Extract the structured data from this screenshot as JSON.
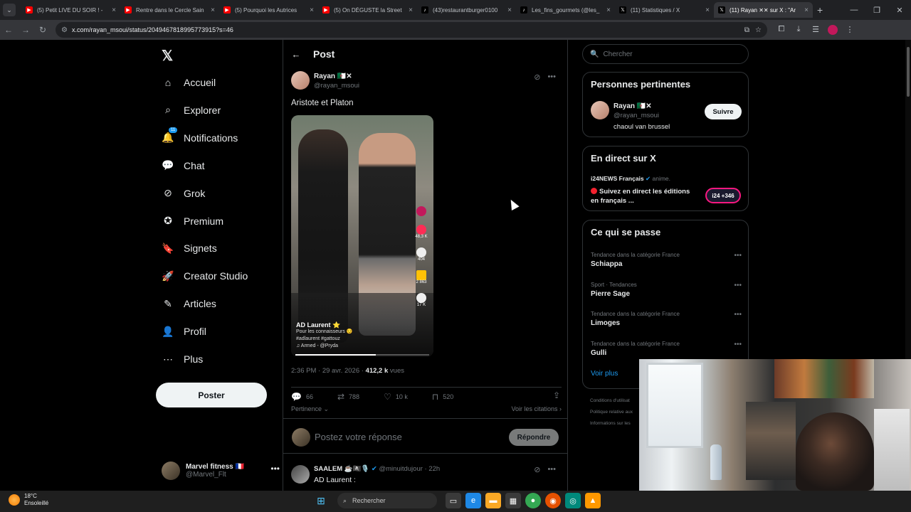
{
  "browser": {
    "tabs": [
      {
        "title": "(5) Petit LIVE DU SOIR ! -",
        "color": "#ff0000",
        "icon": "youtube-icon"
      },
      {
        "title": "Rentre dans le Cercle Sain",
        "color": "#ff0000",
        "icon": "youtube-icon"
      },
      {
        "title": "(5) Pourquoi les Autrices",
        "color": "#ff0000",
        "icon": "youtube-icon"
      },
      {
        "title": "(5) On DÉGUSTE la Street",
        "color": "#ff0000",
        "icon": "youtube-icon"
      },
      {
        "title": "(43)restaurantburger0100",
        "color": "#000000",
        "icon": "tiktok-icon"
      },
      {
        "title": "Les_fins_gourmets (@les_",
        "color": "#000000",
        "icon": "tiktok-icon"
      },
      {
        "title": "(11) Statistiques / X",
        "color": "#000000",
        "icon": "x-icon"
      },
      {
        "title": "(11) Rayan ✕✕ sur X : \"Ar",
        "color": "#000000",
        "icon": "x-icon",
        "active": true
      }
    ],
    "url": "x.com/rayan_msoui/status/2049467818995773915?s=46"
  },
  "nav": {
    "items": [
      {
        "label": "Accueil",
        "icon": "home-icon"
      },
      {
        "label": "Explorer",
        "icon": "search-icon"
      },
      {
        "label": "Notifications",
        "icon": "bell-icon",
        "badge": "11"
      },
      {
        "label": "Chat",
        "icon": "chat-icon"
      },
      {
        "label": "Grok",
        "icon": "grok-icon"
      },
      {
        "label": "Premium",
        "icon": "premium-icon"
      },
      {
        "label": "Signets",
        "icon": "bookmark-icon"
      },
      {
        "label": "Creator Studio",
        "icon": "rocket-icon"
      },
      {
        "label": "Articles",
        "icon": "articles-icon"
      },
      {
        "label": "Profil",
        "icon": "profile-icon"
      },
      {
        "label": "Plus",
        "icon": "more-circle-icon"
      }
    ],
    "post_button": "Poster",
    "account": {
      "name": "Marvel fitness 🇫🇷",
      "handle": "@Marvel_Flt"
    }
  },
  "main": {
    "header_title": "Post",
    "tweet": {
      "author": "Rayan 🇩🇿✕",
      "handle": "@rayan_msoui",
      "text": "Aristote et Platon",
      "video": {
        "caption_user": "AD Laurent ⭐",
        "caption_line1": "Pour les connaisseurs 😏",
        "caption_line2": "#adlaurent #gattouz",
        "caption_music": "♫ Armed - @Pryda",
        "likes": "48,3 K",
        "comments": "404",
        "saves": "2 863",
        "shares": "17 K",
        "progress": 0.6
      },
      "time": "2:36 PM · 29 avr. 2026 · ",
      "views_count": "412,2 k",
      "views_label": " vues",
      "replies": "66",
      "reposts": "788",
      "likes": "10 k",
      "bookmarks": "520"
    },
    "sort_label": "Pertinence ⌄",
    "quotes_label": "Voir les citations ›",
    "reply_placeholder": "Postez votre réponse",
    "reply_button": "Répondre",
    "reply_tweet": {
      "author": "SAALEM ☕🏴‍☠️🎙️",
      "handle": "@minuitdujour",
      "time": " · 22h",
      "text": "AD Laurent :"
    }
  },
  "right": {
    "search_placeholder": "Chercher",
    "relevant": {
      "title": "Personnes pertinentes",
      "name": "Rayan 🇩🇿✕",
      "handle": "@rayan_msoui",
      "bio": "chaoul van brussel",
      "follow": "Suivre"
    },
    "live": {
      "title": "En direct sur X",
      "source": "i24NEWS Français",
      "suffix": " anime.",
      "headline": "Suivez en direct les éditions en français ...",
      "badge": "i24 +346"
    },
    "trending": {
      "title": "Ce qui se passe",
      "items": [
        {
          "context": "Tendance dans la catégorie France",
          "name": "Schiappa"
        },
        {
          "context": "Sport · Tendances",
          "name": "Pierre Sage"
        },
        {
          "context": "Tendance dans la catégorie France",
          "name": "Limoges"
        },
        {
          "context": "Tendance dans la catégorie France",
          "name": "Gulli"
        }
      ],
      "see_more": "Voir plus"
    },
    "footer": [
      "Conditions d'utilisat",
      "Politique relative aux",
      "Informations sur les"
    ]
  },
  "taskbar": {
    "temp": "18°C",
    "weather": "Ensoleillé",
    "search": "Rechercher"
  }
}
